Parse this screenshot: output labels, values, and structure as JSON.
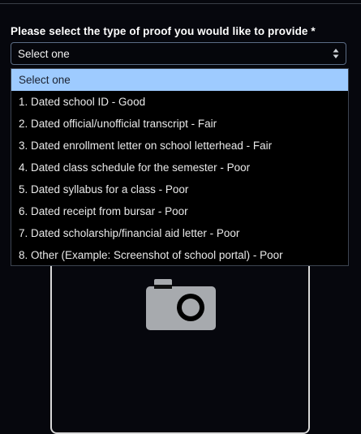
{
  "form": {
    "label": "Please select the type of proof you would like to provide *",
    "select_value": "Select one",
    "options": [
      "Select one",
      "1. Dated school ID - Good",
      "2. Dated official/unofficial transcript - Fair",
      "3. Dated enrollment letter on school letterhead - Fair",
      "4. Dated class schedule for the semester - Poor",
      "5. Dated syllabus for a class - Poor",
      "6. Dated receipt from bursar - Poor",
      "7. Dated scholarship/financial aid letter - Poor",
      "8. Other (Example: Screenshot of school portal) - Poor"
    ],
    "selected_index": 0
  },
  "upload": {
    "icon": "camera-icon"
  },
  "colors": {
    "background": "#06070d",
    "highlight": "#9ecbff",
    "select_border": "#5b6c85",
    "icon_gray": "#a7aaae"
  }
}
